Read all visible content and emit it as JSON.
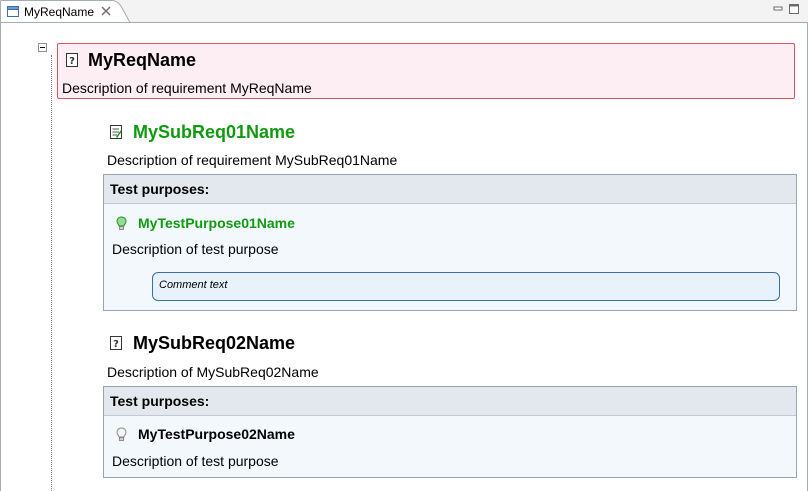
{
  "tab": {
    "label": "MyReqName",
    "close_icon": "close-x-icon",
    "icon": "editor-window-icon"
  },
  "window_controls": {
    "minimize_icon": "minimize-icon",
    "maximize_icon": "maximize-icon"
  },
  "root_requirement": {
    "icon": "requirement-icon",
    "title": "MyReqName",
    "description": "Description of requirement MyReqName",
    "border_color": "#e35163",
    "background_color": "#fdeef4"
  },
  "sub_requirements": [
    {
      "icon": "requirement-edit-icon",
      "title": "MySubReq01Name",
      "title_color": "#109a10",
      "description": "Description of requirement MySubReq01Name",
      "test_purposes_header": "Test purposes:",
      "test_purpose": {
        "icon": "lightbulb-on-icon",
        "name": "MyTestPurpose01Name",
        "description": "Description of test purpose",
        "comment": "Comment text"
      }
    },
    {
      "icon": "requirement-icon",
      "title": "MySubReq02Name",
      "title_color": "#000000",
      "description": "Description of MySubReq02Name",
      "test_purposes_header": "Test purposes:",
      "test_purpose": {
        "icon": "lightbulb-off-icon",
        "name": "MyTestPurpose02Name",
        "description": "Description of test purpose"
      }
    }
  ]
}
